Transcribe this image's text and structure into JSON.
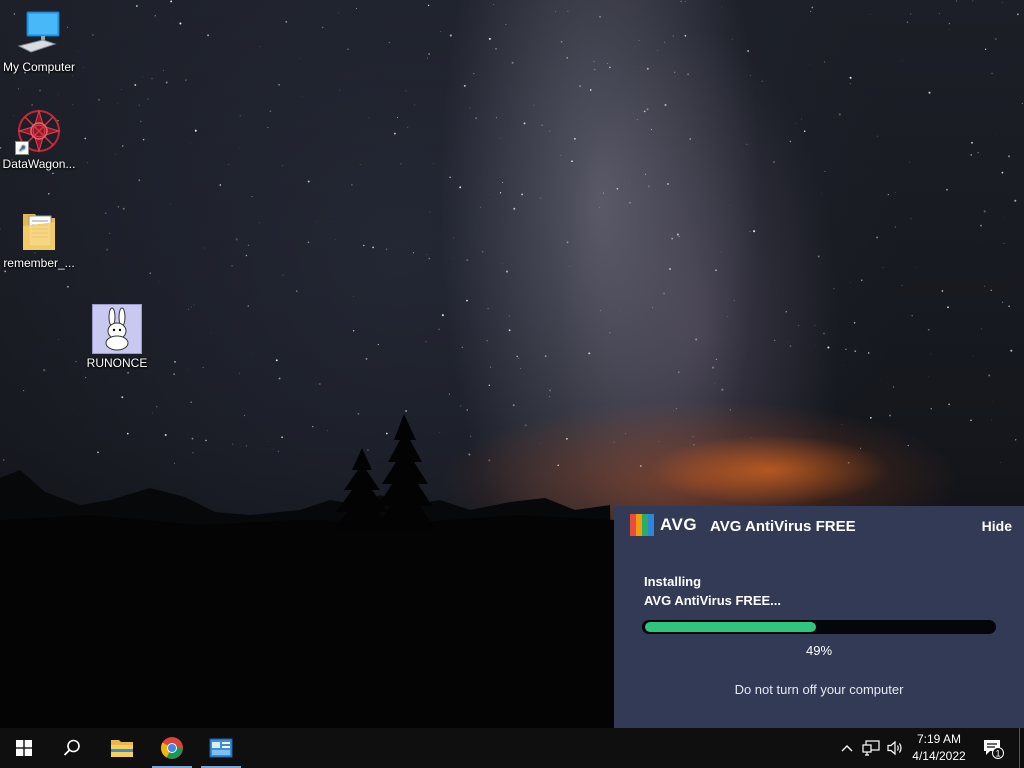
{
  "desktop": {
    "icons": [
      {
        "label": "My Computer"
      },
      {
        "label": "DataWagon..."
      },
      {
        "label": "remember_..."
      },
      {
        "label": "RUNONCE"
      }
    ]
  },
  "avg": {
    "logo_text": "AVG",
    "title": "AVG AntiVirus FREE",
    "hide_label": "Hide",
    "status_line1": "Installing",
    "status_line2": "AVG AntiVirus FREE...",
    "progress": 49,
    "progress_label": "49%",
    "warning": "Do not turn off your computer",
    "colors": {
      "panel": "#323a56",
      "progress": "#2fc57e"
    }
  },
  "taskbar": {
    "clock_time": "7:19 AM",
    "clock_date": "4/14/2022",
    "notification_count": "1",
    "apps": [
      "file-explorer",
      "chrome",
      "control-panel"
    ]
  }
}
